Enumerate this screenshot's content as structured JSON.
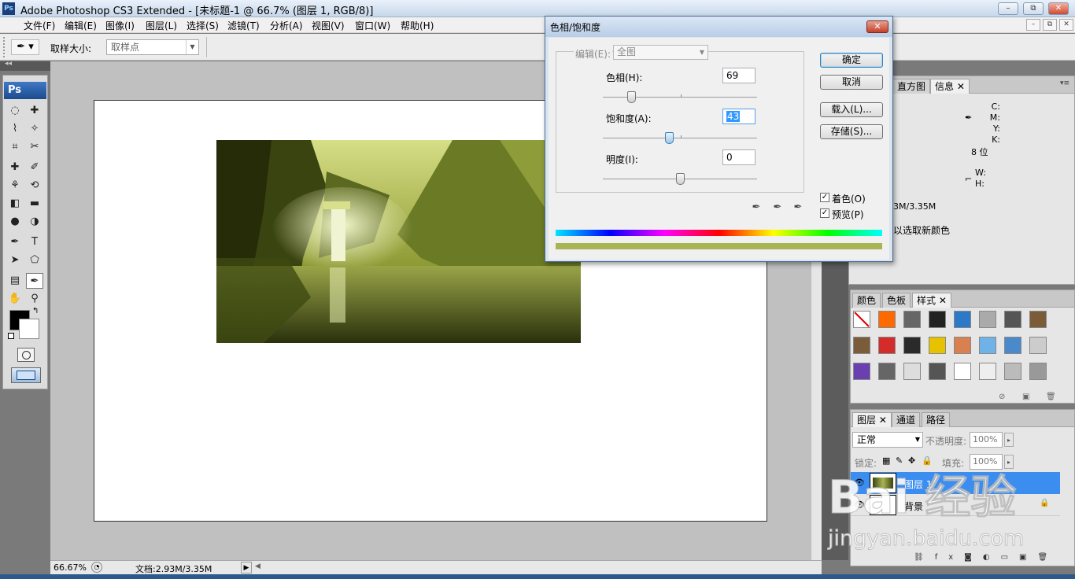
{
  "app": {
    "icon_text": "Ps",
    "title": "Adobe Photoshop CS3 Extended - [未标题-1 @ 66.7% (图层 1, RGB/8)]",
    "window_buttons": [
      "–",
      "⧉",
      "✕"
    ]
  },
  "menu": [
    "文件(F)",
    "编辑(E)",
    "图像(I)",
    "图层(L)",
    "选择(S)",
    "滤镜(T)",
    "分析(A)",
    "视图(V)",
    "窗口(W)",
    "帮助(H)"
  ],
  "options": {
    "sample_size_label": "取样大小:",
    "sample_size_value": "取样点"
  },
  "toolbox": {
    "logo": "Ps",
    "tools": [
      "marquee-icon",
      "move-icon",
      "lasso-icon",
      "magic-wand-icon",
      "crop-icon",
      "slice-icon",
      "healing-icon",
      "brush-icon",
      "clone-stamp-icon",
      "history-brush-icon",
      "eraser-icon",
      "gradient-icon",
      "blur-icon",
      "dodge-icon",
      "pen-icon",
      "type-icon",
      "path-select-icon",
      "shape-icon",
      "notes-icon",
      "eyedropper-icon",
      "hand-icon",
      "zoom-icon"
    ]
  },
  "status": {
    "zoom": "66.67%",
    "doc_size": "文档:2.93M/3.35M"
  },
  "dialog": {
    "title": "色相/饱和度",
    "edit_label": "编辑(E):",
    "edit_value": "全图",
    "hue_label": "色相(H):",
    "hue_value": "69",
    "saturation_label": "饱和度(A):",
    "saturation_value": "43",
    "lightness_label": "明度(I):",
    "lightness_value": "0",
    "ok": "确定",
    "cancel": "取消",
    "load": "载入(L)...",
    "save": "存储(S)...",
    "colorize_label": "着色(O)",
    "colorize_checked": true,
    "preview_label": "预览(P)",
    "preview_checked": true,
    "result_color": "#a9b452"
  },
  "info_panel": {
    "tabs": [
      "直方图",
      "信息"
    ],
    "cmyk_labels": [
      "C:",
      "M:",
      "Y:",
      "K:"
    ],
    "bit_depth": "8 位",
    "wh_labels": [
      "W:",
      "H:"
    ],
    "doc_partial": "3M/3.35M",
    "hint_partial": "以选取新颜色"
  },
  "styles_panel": {
    "tabs": [
      "颜色",
      "色板",
      "样式"
    ]
  },
  "layers_panel": {
    "tabs": [
      "图层",
      "通道",
      "路径"
    ],
    "blend_mode": "正常",
    "opacity_label": "不透明度:",
    "opacity_value": "100%",
    "lock_label": "锁定:",
    "fill_label": "填充:",
    "fill_value": "100%",
    "layers": [
      {
        "name": "图层 1",
        "selected": true
      },
      {
        "name": "背景",
        "selected": false
      }
    ],
    "bottom_icons": [
      "link-icon",
      "fx-icon",
      "mask-icon",
      "adjustment-icon",
      "group-icon",
      "new-layer-icon",
      "trash-icon"
    ]
  },
  "watermark": {
    "brand": "Bai 经验",
    "url": "jingyan.baidu.com"
  }
}
